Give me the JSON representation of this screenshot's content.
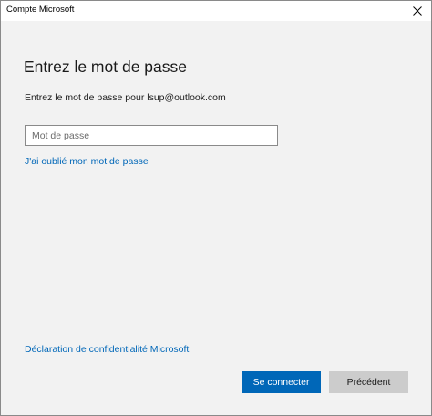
{
  "window": {
    "title": "Compte Microsoft"
  },
  "content": {
    "heading": "Entrez le mot de passe",
    "subtitle": "Entrez le mot de passe pour lsup@outlook.com"
  },
  "password_field": {
    "value": "",
    "placeholder": "Mot de passe"
  },
  "links": {
    "forgot_password": "J'ai oublié mon mot de passe",
    "privacy": "Déclaration de confidentialité Microsoft"
  },
  "buttons": {
    "sign_in": "Se connecter",
    "back": "Précédent"
  },
  "icons": {
    "close": "close-icon"
  },
  "colors": {
    "accent": "#0067b8",
    "background": "#f2f2f2",
    "secondary_button": "#cccccc"
  }
}
